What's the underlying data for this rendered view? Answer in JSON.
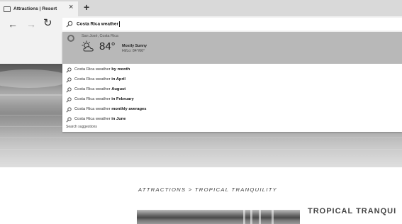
{
  "tab": {
    "title": "Attractions | Resort",
    "close": "×",
    "new_tab": "+"
  },
  "nav": {
    "back": "←",
    "forward": "→",
    "refresh": "↻"
  },
  "address": {
    "value": "Costa Rica weather"
  },
  "weather": {
    "location": "San José, Costa Rica",
    "temp": "84°",
    "condition": "Mostly Sunny",
    "hilo": "Hi/Lo: 84°/66°"
  },
  "suggestions": {
    "prefix": "Costa Rica weather ",
    "items": [
      {
        "suffix": "by month"
      },
      {
        "suffix": "in April"
      },
      {
        "suffix": "August"
      },
      {
        "suffix": "in February"
      },
      {
        "suffix": "monthly averages"
      },
      {
        "suffix": "in June"
      }
    ],
    "footer": "Search suggestions"
  },
  "page": {
    "breadcrumb": "ATTRACTIONS > TROPICAL TRANQUILITY",
    "section_title": "TROPICAL TRANQUI"
  }
}
